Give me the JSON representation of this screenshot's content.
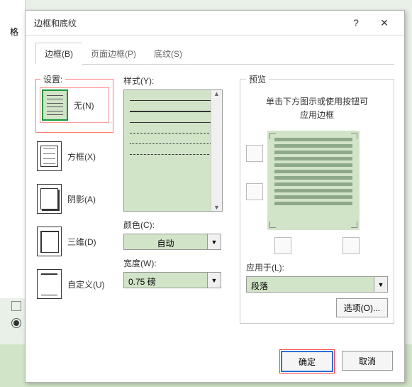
{
  "backpanel": {
    "char": "格"
  },
  "dialog": {
    "title": "边框和底纹",
    "help": "?",
    "close": "✕"
  },
  "tabs": {
    "borders": "边框(B)",
    "page": "页面边框(P)",
    "shading": "底纹(S)"
  },
  "settings": {
    "legend": "设置:",
    "none": "无(N)",
    "box": "方框(X)",
    "shadow": "阴影(A)",
    "threeD": "三维(D)",
    "custom": "自定义(U)"
  },
  "style": {
    "label": "样式(Y):",
    "color_label": "颜色(C):",
    "color_value": "自动",
    "width_label": "宽度(W):",
    "width_value": "0.75 磅"
  },
  "preview": {
    "legend": "预览",
    "hint1": "单击下方图示或使用按钮可",
    "hint2": "应用边框",
    "apply_label": "应用于(L):",
    "apply_value": "段落",
    "options": "选项(O)..."
  },
  "buttons": {
    "ok": "确定",
    "cancel": "取消"
  }
}
